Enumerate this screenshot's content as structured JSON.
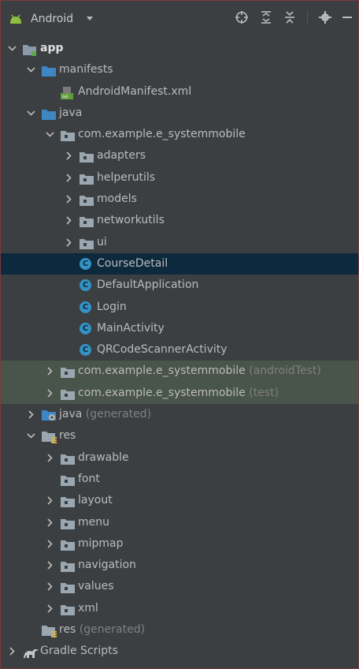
{
  "toolbar": {
    "view_label": "Android",
    "icons": [
      "locate-icon",
      "expand-all-icon",
      "collapse-all-icon",
      "gear-icon",
      "hide-icon"
    ]
  },
  "tree": [
    {
      "label": "app",
      "level": 0,
      "expanded": true,
      "icon": "module-folder-icon",
      "bold": true
    },
    {
      "label": "manifests",
      "level": 1,
      "expanded": true,
      "icon": "folder-icon"
    },
    {
      "label": "AndroidManifest.xml",
      "level": 2,
      "expanded": null,
      "icon": "manifest-file-icon"
    },
    {
      "label": "java",
      "level": 1,
      "expanded": true,
      "icon": "folder-icon"
    },
    {
      "label": "com.example.e_systemmobile",
      "level": 2,
      "expanded": true,
      "icon": "package-icon"
    },
    {
      "label": "adapters",
      "level": 3,
      "expanded": false,
      "icon": "package-icon"
    },
    {
      "label": "helperutils",
      "level": 3,
      "expanded": false,
      "icon": "package-icon"
    },
    {
      "label": "models",
      "level": 3,
      "expanded": false,
      "icon": "package-icon"
    },
    {
      "label": "networkutils",
      "level": 3,
      "expanded": false,
      "icon": "package-icon"
    },
    {
      "label": "ui",
      "level": 3,
      "expanded": false,
      "icon": "package-icon"
    },
    {
      "label": "CourseDetail",
      "level": 3,
      "expanded": null,
      "icon": "class-icon",
      "selected": true
    },
    {
      "label": "DefaultApplication",
      "level": 3,
      "expanded": null,
      "icon": "class-icon"
    },
    {
      "label": "Login",
      "level": 3,
      "expanded": null,
      "icon": "class-icon"
    },
    {
      "label": "MainActivity",
      "level": 3,
      "expanded": null,
      "icon": "class-icon"
    },
    {
      "label": "QRCodeScannerActivity",
      "level": 3,
      "expanded": null,
      "icon": "class-icon"
    },
    {
      "label": "com.example.e_systemmobile",
      "suffix": "(androidTest)",
      "level": 2,
      "expanded": false,
      "icon": "package-icon",
      "group": true
    },
    {
      "label": "com.example.e_systemmobile",
      "suffix": "(test)",
      "level": 2,
      "expanded": false,
      "icon": "package-icon",
      "group": true
    },
    {
      "label": "java",
      "suffix": "(generated)",
      "level": 1,
      "expanded": false,
      "icon": "generated-folder-icon"
    },
    {
      "label": "res",
      "level": 1,
      "expanded": true,
      "icon": "res-folder-icon"
    },
    {
      "label": "drawable",
      "level": 2,
      "expanded": false,
      "icon": "package-icon"
    },
    {
      "label": "font",
      "level": 2,
      "expanded": null,
      "icon": "package-icon"
    },
    {
      "label": "layout",
      "level": 2,
      "expanded": false,
      "icon": "package-icon"
    },
    {
      "label": "menu",
      "level": 2,
      "expanded": false,
      "icon": "package-icon"
    },
    {
      "label": "mipmap",
      "level": 2,
      "expanded": false,
      "icon": "package-icon"
    },
    {
      "label": "navigation",
      "level": 2,
      "expanded": false,
      "icon": "package-icon"
    },
    {
      "label": "values",
      "level": 2,
      "expanded": false,
      "icon": "package-icon"
    },
    {
      "label": "xml",
      "level": 2,
      "expanded": false,
      "icon": "package-icon"
    },
    {
      "label": "res",
      "suffix": "(generated)",
      "level": 1,
      "expanded": null,
      "icon": "res-folder-icon"
    },
    {
      "label": "Gradle Scripts",
      "level": 0,
      "expanded": false,
      "icon": "gradle-icon"
    }
  ]
}
